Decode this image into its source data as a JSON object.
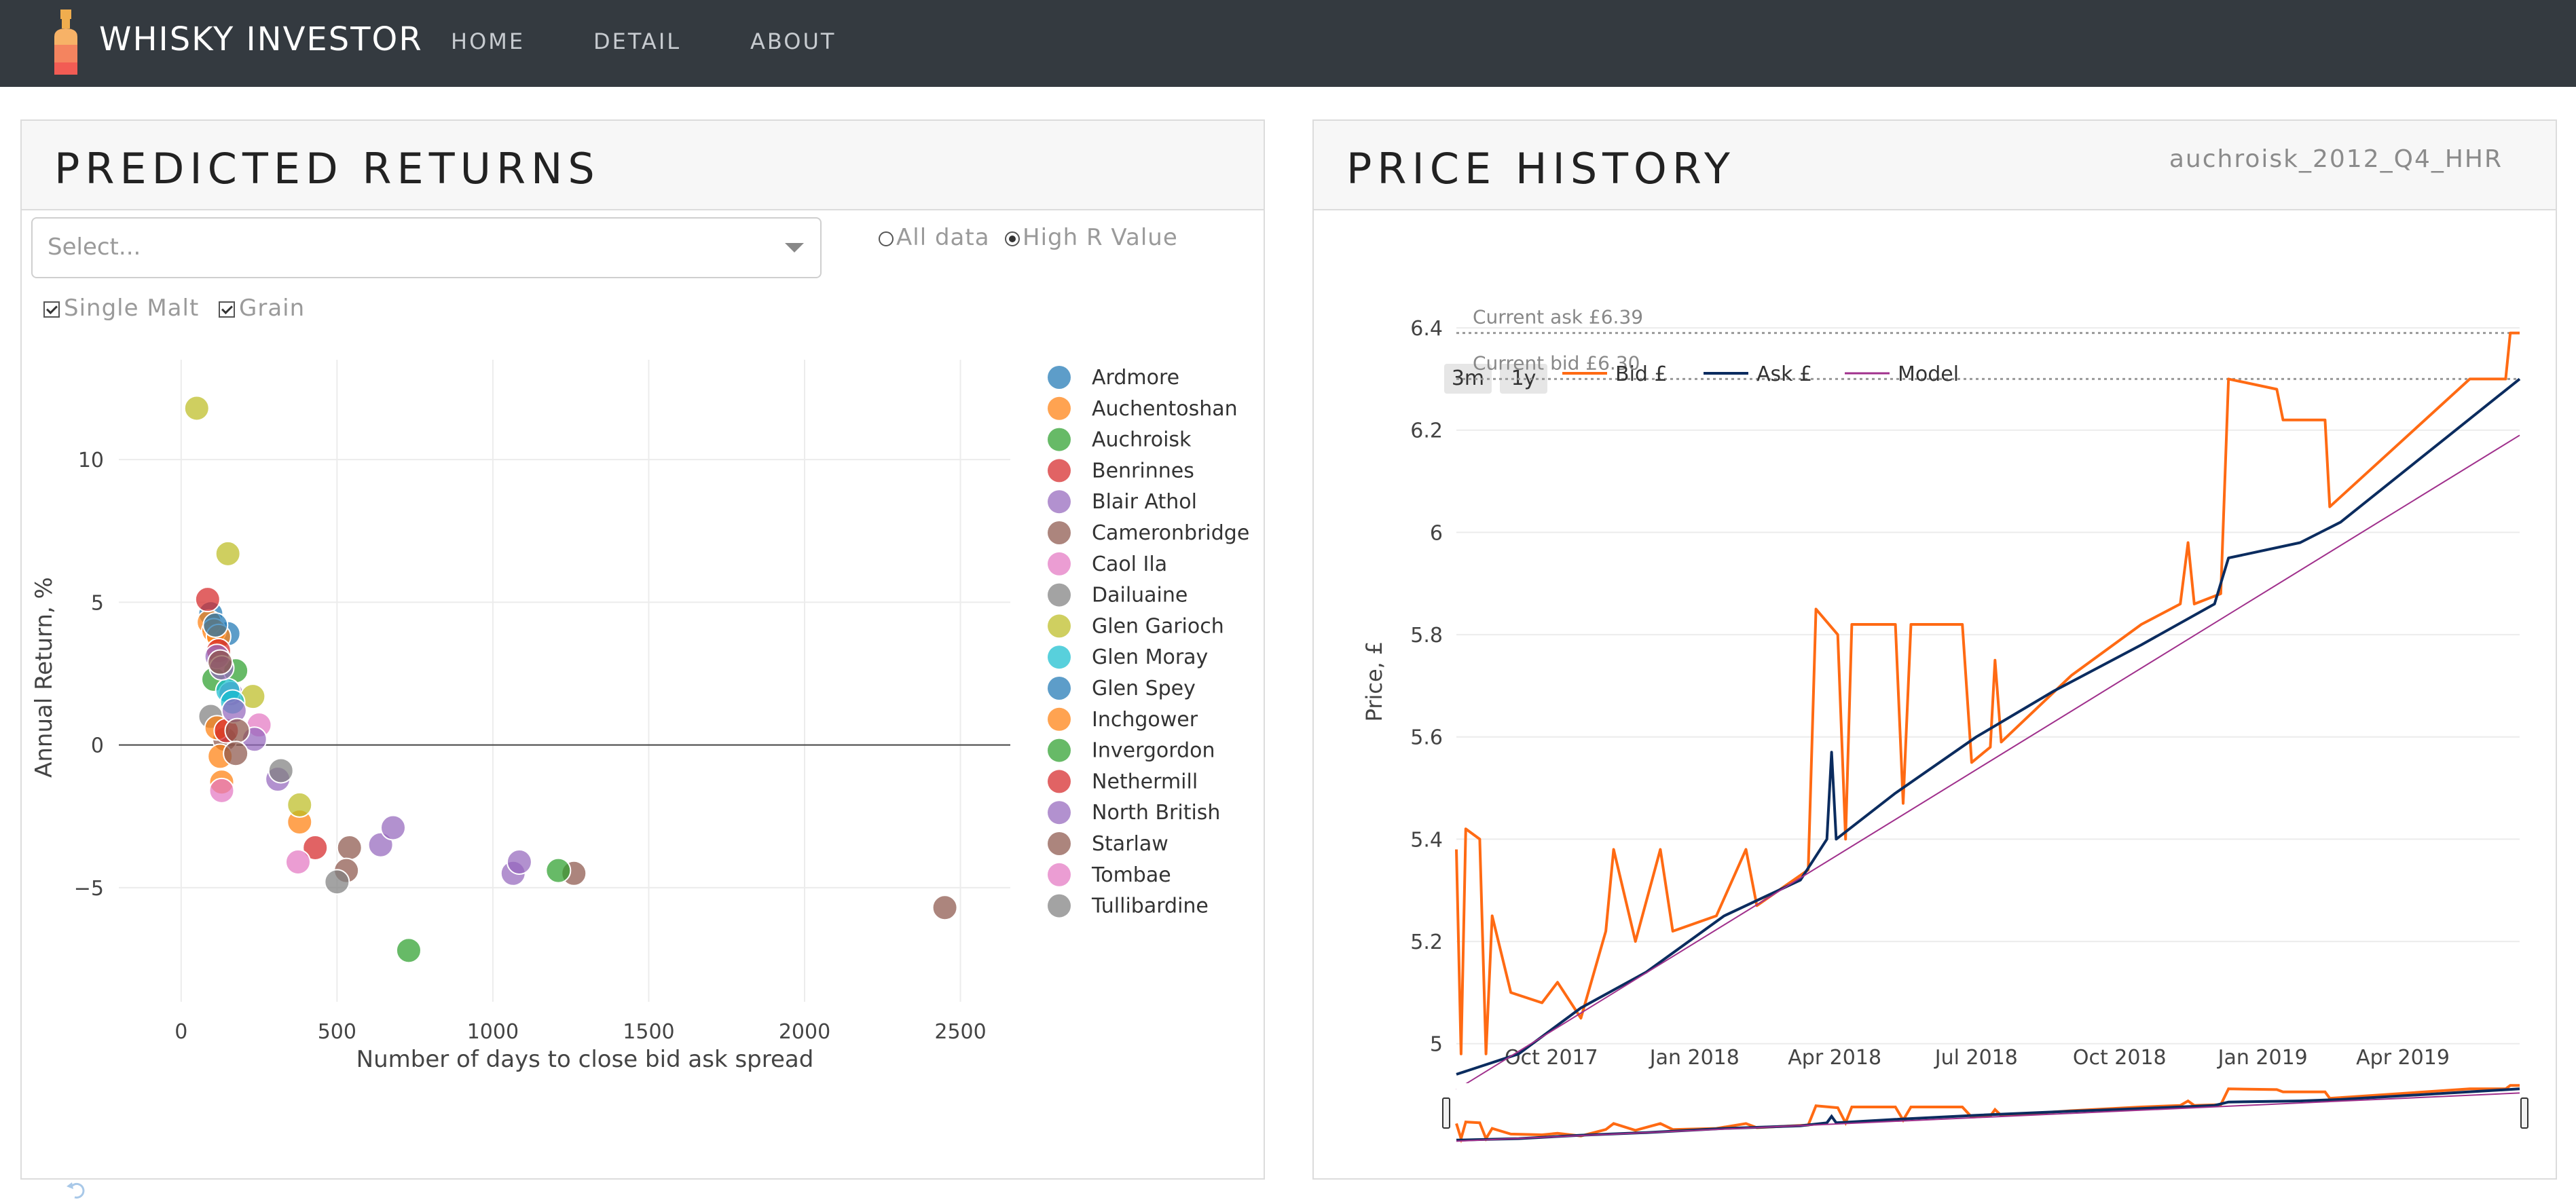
{
  "app": {
    "title": "WHISKY INVESTOR",
    "nav": [
      "HOME",
      "DETAIL",
      "ABOUT"
    ]
  },
  "left_panel": {
    "title": "PREDICTED RETURNS",
    "select_placeholder": "Select...",
    "radio_options": [
      {
        "label": "All data",
        "selected": false
      },
      {
        "label": "High R Value",
        "selected": true
      }
    ],
    "checkboxes": [
      {
        "label": "Single Malt",
        "checked": true
      },
      {
        "label": "Grain",
        "checked": true
      }
    ]
  },
  "right_panel": {
    "title": "PRICE HISTORY",
    "subtitle": "auchroisk_2012_Q4_HHR",
    "range_buttons": [
      "3m",
      "1y"
    ]
  },
  "chart_data": [
    {
      "type": "scatter",
      "xlabel": "Number of days to close bid ask spread",
      "ylabel": "Annual Return, %",
      "xlim": [
        -200,
        2660
      ],
      "ylim": [
        -9,
        13.5
      ],
      "x_ticks": [
        0,
        500,
        1000,
        1500,
        2000,
        2500
      ],
      "x_tick_labels": [
        "0",
        "500",
        "1000",
        "1500",
        "2000",
        "2500"
      ],
      "y_ticks": [
        10,
        5,
        0,
        -5
      ],
      "y_tick_labels": [
        "10",
        "5",
        "0",
        "−5"
      ],
      "legend_position": "right",
      "series": [
        {
          "name": "Ardmore",
          "color": "#1f77b4",
          "points": [
            [
              95,
              4.6
            ],
            [
              150,
              3.9
            ]
          ]
        },
        {
          "name": "Auchentoshan",
          "color": "#ff7f0e",
          "points": [
            [
              90,
              4.3
            ],
            [
              105,
              4.0
            ],
            [
              120,
              3.8
            ],
            [
              380,
              -2.7
            ]
          ]
        },
        {
          "name": "Auchroisk",
          "color": "#2ca02c",
          "points": [
            [
              105,
              2.3
            ],
            [
              175,
              2.6
            ]
          ]
        },
        {
          "name": "Benrinnes",
          "color": "#d62728",
          "points": [
            [
              85,
              5.1
            ],
            [
              120,
              3.3
            ],
            [
              430,
              -3.6
            ]
          ]
        },
        {
          "name": "Blair Athol",
          "color": "#9467bd",
          "points": [
            [
              115,
              3.1
            ],
            [
              160,
              1.8
            ]
          ]
        },
        {
          "name": "Cameronbridge",
          "color": "#8c564b",
          "points": [
            [
              140,
              0.2
            ],
            [
              540,
              -3.6
            ],
            [
              530,
              -4.4
            ],
            [
              1260,
              -4.5
            ],
            [
              2450,
              -5.7
            ]
          ]
        },
        {
          "name": "Caol Ila",
          "color": "#e377c2",
          "points": [
            [
              250,
              0.7
            ],
            [
              375,
              -4.1
            ]
          ]
        },
        {
          "name": "Dailuaine",
          "color": "#7f7f7f",
          "points": [
            [
              95,
              1.0
            ],
            [
              500,
              -4.8
            ]
          ]
        },
        {
          "name": "Glen Garioch",
          "color": "#bcbd22",
          "points": [
            [
              50,
              11.8
            ],
            [
              150,
              6.7
            ],
            [
              230,
              1.7
            ],
            [
              380,
              -2.1
            ]
          ]
        },
        {
          "name": "Glen Moray",
          "color": "#17becf",
          "points": [
            [
              150,
              1.9
            ],
            [
              165,
              1.5
            ]
          ]
        },
        {
          "name": "Glen Spey",
          "color": "#1f77b4",
          "points": [
            [
              110,
              4.2
            ]
          ]
        },
        {
          "name": "Inchgower",
          "color": "#ff7f0e",
          "points": [
            [
              115,
              0.6
            ],
            [
              125,
              -0.4
            ],
            [
              130,
              -1.3
            ]
          ]
        },
        {
          "name": "Invergordon",
          "color": "#2ca02c",
          "points": [
            [
              730,
              -7.2
            ],
            [
              1210,
              -4.4
            ]
          ]
        },
        {
          "name": "Nethermill",
          "color": "#d62728",
          "points": [
            [
              145,
              0.5
            ]
          ]
        },
        {
          "name": "North British",
          "color": "#9467bd",
          "points": [
            [
              130,
              2.7
            ],
            [
              170,
              1.2
            ],
            [
              235,
              0.2
            ],
            [
              310,
              -1.2
            ],
            [
              640,
              -3.5
            ],
            [
              680,
              -2.9
            ],
            [
              1065,
              -4.5
            ],
            [
              1085,
              -4.1
            ]
          ]
        },
        {
          "name": "Starlaw",
          "color": "#8c564b",
          "points": [
            [
              125,
              2.9
            ],
            [
              180,
              0.5
            ],
            [
              175,
              -0.3
            ]
          ]
        },
        {
          "name": "Tombae",
          "color": "#e377c2",
          "points": [
            [
              130,
              -1.6
            ]
          ]
        },
        {
          "name": "Tullibardine",
          "color": "#7f7f7f",
          "points": [
            [
              320,
              -0.9
            ]
          ]
        }
      ]
    },
    {
      "type": "line",
      "xlabel": "",
      "ylabel": "Price, £",
      "ylim": [
        4.92,
        6.42
      ],
      "y_ticks": [
        5.0,
        5.2,
        5.4,
        5.6,
        5.8,
        6.0,
        6.2,
        6.4
      ],
      "y_tick_labels": [
        "5",
        "5.2",
        "5.4",
        "5.6",
        "5.8",
        "6",
        "6.2",
        "6.4"
      ],
      "x_range": [
        "2017-08-01",
        "2019-06-15"
      ],
      "x_ticks": [
        "2017-10-01",
        "2018-01-01",
        "2018-04-01",
        "2018-07-01",
        "2018-10-01",
        "2019-01-01",
        "2019-04-01"
      ],
      "x_tick_labels": [
        "Oct 2017",
        "Jan 2018",
        "Apr 2018",
        "Jul 2018",
        "Oct 2018",
        "Jan 2019",
        "Apr 2019"
      ],
      "legend_position": "top",
      "annotations": [
        {
          "text": "Current ask £6.39",
          "value": 6.39
        },
        {
          "text": "Current bid £6.30",
          "value": 6.3
        }
      ],
      "series": [
        {
          "name": "Bid £",
          "color": "#ff6a13",
          "points": [
            [
              "2017-08-01",
              5.38
            ],
            [
              "2017-08-04",
              4.98
            ],
            [
              "2017-08-07",
              5.42
            ],
            [
              "2017-08-16",
              5.4
            ],
            [
              "2017-08-20",
              4.98
            ],
            [
              "2017-08-24",
              5.25
            ],
            [
              "2017-09-05",
              5.1
            ],
            [
              "2017-09-25",
              5.08
            ],
            [
              "2017-10-05",
              5.12
            ],
            [
              "2017-10-20",
              5.05
            ],
            [
              "2017-11-05",
              5.22
            ],
            [
              "2017-11-10",
              5.38
            ],
            [
              "2017-11-24",
              5.2
            ],
            [
              "2017-12-10",
              5.38
            ],
            [
              "2017-12-18",
              5.22
            ],
            [
              "2018-01-15",
              5.25
            ],
            [
              "2018-02-03",
              5.38
            ],
            [
              "2018-02-10",
              5.27
            ],
            [
              "2018-03-15",
              5.34
            ],
            [
              "2018-03-20",
              5.85
            ],
            [
              "2018-04-03",
              5.8
            ],
            [
              "2018-04-08",
              5.4
            ],
            [
              "2018-04-12",
              5.82
            ],
            [
              "2018-05-10",
              5.82
            ],
            [
              "2018-05-15",
              5.47
            ],
            [
              "2018-05-20",
              5.82
            ],
            [
              "2018-06-22",
              5.82
            ],
            [
              "2018-06-28",
              5.55
            ],
            [
              "2018-07-10",
              5.58
            ],
            [
              "2018-07-13",
              5.75
            ],
            [
              "2018-07-17",
              5.59
            ],
            [
              "2018-08-31",
              5.72
            ],
            [
              "2018-10-15",
              5.82
            ],
            [
              "2018-11-09",
              5.86
            ],
            [
              "2018-11-14",
              5.98
            ],
            [
              "2018-11-18",
              5.86
            ],
            [
              "2018-12-05",
              5.88
            ],
            [
              "2018-12-10",
              6.3
            ],
            [
              "2019-01-10",
              6.28
            ],
            [
              "2019-01-14",
              6.22
            ],
            [
              "2019-02-10",
              6.22
            ],
            [
              "2019-02-13",
              6.05
            ],
            [
              "2019-05-14",
              6.3
            ],
            [
              "2019-06-06",
              6.3
            ],
            [
              "2019-06-09",
              6.39
            ],
            [
              "2019-06-15",
              6.39
            ]
          ]
        },
        {
          "name": "Ask £",
          "color": "#0b2c5f",
          "points": [
            [
              "2017-08-01",
              4.94
            ],
            [
              "2017-09-10",
              4.98
            ],
            [
              "2017-10-20",
              5.07
            ],
            [
              "2017-12-01",
              5.14
            ],
            [
              "2018-01-20",
              5.25
            ],
            [
              "2018-03-10",
              5.32
            ],
            [
              "2018-03-27",
              5.4
            ],
            [
              "2018-03-30",
              5.57
            ],
            [
              "2018-04-02",
              5.4
            ],
            [
              "2018-05-10",
              5.49
            ],
            [
              "2018-07-01",
              5.6
            ],
            [
              "2018-08-20",
              5.69
            ],
            [
              "2018-10-15",
              5.78
            ],
            [
              "2018-12-01",
              5.86
            ],
            [
              "2018-12-10",
              5.95
            ],
            [
              "2019-01-25",
              5.98
            ],
            [
              "2019-02-20",
              6.02
            ],
            [
              "2019-06-15",
              6.3
            ]
          ]
        },
        {
          "name": "Model",
          "color": "#a0308c",
          "points": [
            [
              "2017-08-01",
              4.91
            ],
            [
              "2019-06-15",
              6.19
            ]
          ]
        }
      ]
    }
  ]
}
